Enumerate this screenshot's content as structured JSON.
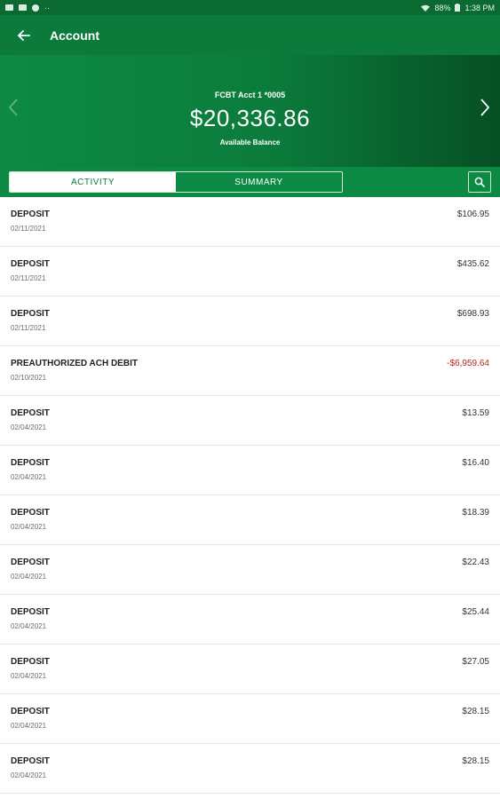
{
  "status_bar": {
    "battery": "88%",
    "time": "1:38 PM"
  },
  "app_bar": {
    "title": "Account"
  },
  "account": {
    "name": "FCBT Acct 1 *0005",
    "balance": "$20,336.86",
    "balance_label": "Available Balance"
  },
  "tabs": [
    {
      "label": "ACTIVITY",
      "active": true
    },
    {
      "label": "SUMMARY",
      "active": false
    }
  ],
  "transactions": [
    {
      "description": "DEPOSIT",
      "date": "02/11/2021",
      "amount": "$106.95"
    },
    {
      "description": "DEPOSIT",
      "date": "02/11/2021",
      "amount": "$435.62"
    },
    {
      "description": "DEPOSIT",
      "date": "02/11/2021",
      "amount": "$698.93"
    },
    {
      "description": "PREAUTHORIZED ACH DEBIT",
      "date": "02/10/2021",
      "amount": "-$6,959.64"
    },
    {
      "description": "DEPOSIT",
      "date": "02/04/2021",
      "amount": "$13.59"
    },
    {
      "description": "DEPOSIT",
      "date": "02/04/2021",
      "amount": "$16.40"
    },
    {
      "description": "DEPOSIT",
      "date": "02/04/2021",
      "amount": "$18.39"
    },
    {
      "description": "DEPOSIT",
      "date": "02/04/2021",
      "amount": "$22.43"
    },
    {
      "description": "DEPOSIT",
      "date": "02/04/2021",
      "amount": "$25.44"
    },
    {
      "description": "DEPOSIT",
      "date": "02/04/2021",
      "amount": "$27.05"
    },
    {
      "description": "DEPOSIT",
      "date": "02/04/2021",
      "amount": "$28.15"
    },
    {
      "description": "DEPOSIT",
      "date": "02/04/2021",
      "amount": "$28.15"
    }
  ],
  "colors": {
    "brand_green": "#0c7a3a",
    "negative_red": "#b3261e"
  },
  "icons": [
    "back-arrow-icon",
    "chevron-left-icon",
    "chevron-right-icon",
    "search-icon",
    "wifi-icon",
    "battery-icon"
  ]
}
